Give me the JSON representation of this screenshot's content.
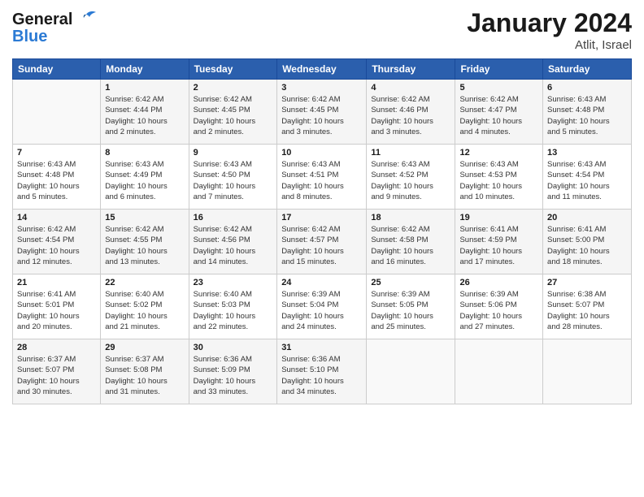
{
  "logo": {
    "line1": "General",
    "line2": "Blue"
  },
  "header": {
    "title": "January 2024",
    "subtitle": "Atlit, Israel"
  },
  "weekdays": [
    "Sunday",
    "Monday",
    "Tuesday",
    "Wednesday",
    "Thursday",
    "Friday",
    "Saturday"
  ],
  "weeks": [
    [
      {
        "day": "",
        "info": ""
      },
      {
        "day": "1",
        "info": "Sunrise: 6:42 AM\nSunset: 4:44 PM\nDaylight: 10 hours\nand 2 minutes."
      },
      {
        "day": "2",
        "info": "Sunrise: 6:42 AM\nSunset: 4:45 PM\nDaylight: 10 hours\nand 2 minutes."
      },
      {
        "day": "3",
        "info": "Sunrise: 6:42 AM\nSunset: 4:45 PM\nDaylight: 10 hours\nand 3 minutes."
      },
      {
        "day": "4",
        "info": "Sunrise: 6:42 AM\nSunset: 4:46 PM\nDaylight: 10 hours\nand 3 minutes."
      },
      {
        "day": "5",
        "info": "Sunrise: 6:42 AM\nSunset: 4:47 PM\nDaylight: 10 hours\nand 4 minutes."
      },
      {
        "day": "6",
        "info": "Sunrise: 6:43 AM\nSunset: 4:48 PM\nDaylight: 10 hours\nand 5 minutes."
      }
    ],
    [
      {
        "day": "7",
        "info": "Sunrise: 6:43 AM\nSunset: 4:48 PM\nDaylight: 10 hours\nand 5 minutes."
      },
      {
        "day": "8",
        "info": "Sunrise: 6:43 AM\nSunset: 4:49 PM\nDaylight: 10 hours\nand 6 minutes."
      },
      {
        "day": "9",
        "info": "Sunrise: 6:43 AM\nSunset: 4:50 PM\nDaylight: 10 hours\nand 7 minutes."
      },
      {
        "day": "10",
        "info": "Sunrise: 6:43 AM\nSunset: 4:51 PM\nDaylight: 10 hours\nand 8 minutes."
      },
      {
        "day": "11",
        "info": "Sunrise: 6:43 AM\nSunset: 4:52 PM\nDaylight: 10 hours\nand 9 minutes."
      },
      {
        "day": "12",
        "info": "Sunrise: 6:43 AM\nSunset: 4:53 PM\nDaylight: 10 hours\nand 10 minutes."
      },
      {
        "day": "13",
        "info": "Sunrise: 6:43 AM\nSunset: 4:54 PM\nDaylight: 10 hours\nand 11 minutes."
      }
    ],
    [
      {
        "day": "14",
        "info": "Sunrise: 6:42 AM\nSunset: 4:54 PM\nDaylight: 10 hours\nand 12 minutes."
      },
      {
        "day": "15",
        "info": "Sunrise: 6:42 AM\nSunset: 4:55 PM\nDaylight: 10 hours\nand 13 minutes."
      },
      {
        "day": "16",
        "info": "Sunrise: 6:42 AM\nSunset: 4:56 PM\nDaylight: 10 hours\nand 14 minutes."
      },
      {
        "day": "17",
        "info": "Sunrise: 6:42 AM\nSunset: 4:57 PM\nDaylight: 10 hours\nand 15 minutes."
      },
      {
        "day": "18",
        "info": "Sunrise: 6:42 AM\nSunset: 4:58 PM\nDaylight: 10 hours\nand 16 minutes."
      },
      {
        "day": "19",
        "info": "Sunrise: 6:41 AM\nSunset: 4:59 PM\nDaylight: 10 hours\nand 17 minutes."
      },
      {
        "day": "20",
        "info": "Sunrise: 6:41 AM\nSunset: 5:00 PM\nDaylight: 10 hours\nand 18 minutes."
      }
    ],
    [
      {
        "day": "21",
        "info": "Sunrise: 6:41 AM\nSunset: 5:01 PM\nDaylight: 10 hours\nand 20 minutes."
      },
      {
        "day": "22",
        "info": "Sunrise: 6:40 AM\nSunset: 5:02 PM\nDaylight: 10 hours\nand 21 minutes."
      },
      {
        "day": "23",
        "info": "Sunrise: 6:40 AM\nSunset: 5:03 PM\nDaylight: 10 hours\nand 22 minutes."
      },
      {
        "day": "24",
        "info": "Sunrise: 6:39 AM\nSunset: 5:04 PM\nDaylight: 10 hours\nand 24 minutes."
      },
      {
        "day": "25",
        "info": "Sunrise: 6:39 AM\nSunset: 5:05 PM\nDaylight: 10 hours\nand 25 minutes."
      },
      {
        "day": "26",
        "info": "Sunrise: 6:39 AM\nSunset: 5:06 PM\nDaylight: 10 hours\nand 27 minutes."
      },
      {
        "day": "27",
        "info": "Sunrise: 6:38 AM\nSunset: 5:07 PM\nDaylight: 10 hours\nand 28 minutes."
      }
    ],
    [
      {
        "day": "28",
        "info": "Sunrise: 6:37 AM\nSunset: 5:07 PM\nDaylight: 10 hours\nand 30 minutes."
      },
      {
        "day": "29",
        "info": "Sunrise: 6:37 AM\nSunset: 5:08 PM\nDaylight: 10 hours\nand 31 minutes."
      },
      {
        "day": "30",
        "info": "Sunrise: 6:36 AM\nSunset: 5:09 PM\nDaylight: 10 hours\nand 33 minutes."
      },
      {
        "day": "31",
        "info": "Sunrise: 6:36 AM\nSunset: 5:10 PM\nDaylight: 10 hours\nand 34 minutes."
      },
      {
        "day": "",
        "info": ""
      },
      {
        "day": "",
        "info": ""
      },
      {
        "day": "",
        "info": ""
      }
    ]
  ]
}
